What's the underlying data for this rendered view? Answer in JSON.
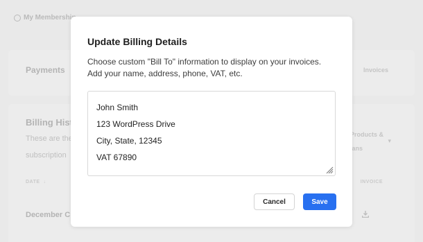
{
  "background": {
    "header": {
      "label": "My Membership"
    },
    "payments_card": {
      "tab_payments": "Payments",
      "tab_invoices": "Invoices"
    },
    "billing_history": {
      "title": "Billing History",
      "desc_line1": "These are the",
      "desc_line2": "subscription",
      "filter_line1": "All Products &",
      "filter_line2": "Plans",
      "col_date": "DATE",
      "col_invoice": "INVOICE",
      "row_date": "December C"
    }
  },
  "modal": {
    "title": "Update Billing Details",
    "description_line1": "Choose custom \"Bill To\" information to display on your invoices.",
    "description_line2": "Add your name, address, phone, VAT, etc.",
    "textarea_lines": [
      "John Smith",
      "123 WordPress Drive",
      "City, State, 12345",
      "VAT 67890"
    ],
    "cancel_label": "Cancel",
    "save_label": "Save"
  },
  "colors": {
    "primary": "#2870f0",
    "overlay": "#e1e1e1"
  },
  "icons": {
    "user": "user-circle-icon",
    "download": "download-icon",
    "sort": "arrow-down-icon",
    "chevron": "chevron-down-icon",
    "resize": "resize-handle-icon"
  }
}
